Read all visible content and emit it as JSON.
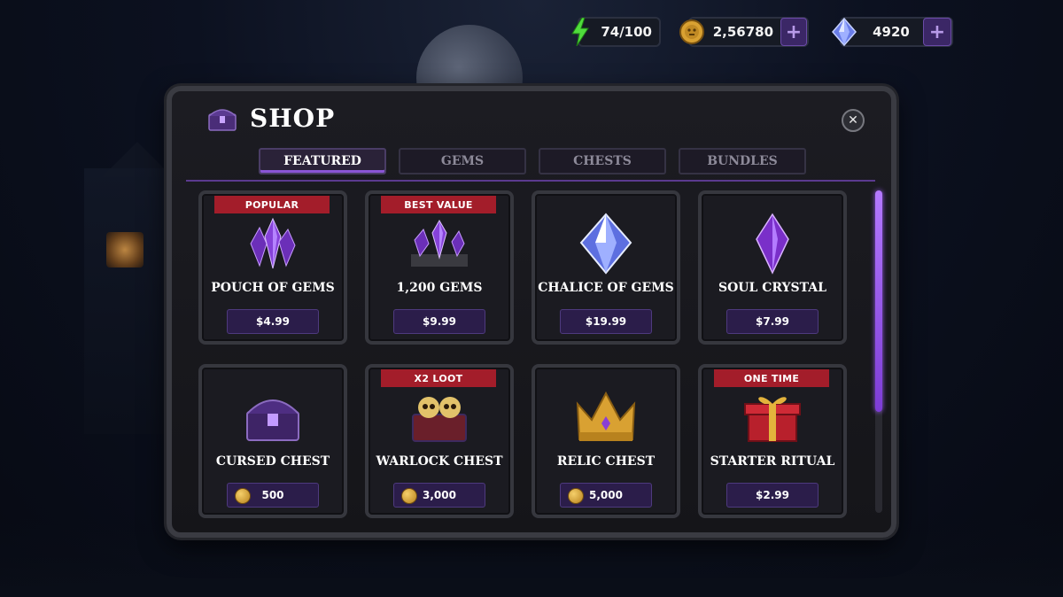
{
  "resources": {
    "energy": {
      "value": "74/100",
      "icon": "lightning-icon"
    },
    "gold": {
      "value": "2,56780",
      "icon": "coin-icon"
    },
    "gems": {
      "value": "4920",
      "icon": "diamond-icon"
    },
    "plus_label": "+"
  },
  "shop": {
    "title": "SHOP",
    "close_label": "✕",
    "tabs": [
      {
        "label": "FEATURED",
        "active": true
      },
      {
        "label": "GEMS",
        "active": false
      },
      {
        "label": "CHESTS",
        "active": false
      },
      {
        "label": "BUNDLES",
        "active": false
      }
    ],
    "items": [
      {
        "badge": "POPULAR",
        "name": "POUCH OF GEMS",
        "price": "$4.99",
        "icon": "gem-cluster-icon"
      },
      {
        "badge": "BEST VALUE",
        "name": "1,200 GEMS",
        "price": "$9.99",
        "icon": "gem-pile-icon"
      },
      {
        "badge": "",
        "name": "CHALICE OF GEMS",
        "price": "$19.99",
        "icon": "diamond-icon"
      },
      {
        "badge": "",
        "name": "SOUL CRYSTAL",
        "price": "$7.99",
        "icon": "crystal-icon"
      },
      {
        "badge": "",
        "name": "CURSED CHEST",
        "price": "500",
        "icon": "chest-icon",
        "currency": "coin"
      },
      {
        "badge": "X2 LOOT",
        "name": "WARLOCK CHEST",
        "price": "3,000",
        "icon": "skull-chest-icon",
        "currency": "coin"
      },
      {
        "badge": "",
        "name": "RELIC CHEST",
        "price": "5,000",
        "icon": "crown-icon",
        "currency": "coin"
      },
      {
        "badge": "ONE TIME",
        "name": "STARTER RITUAL",
        "price": "$2.99",
        "icon": "gift-icon"
      }
    ]
  },
  "colors": {
    "accent": "#8a55d6",
    "badge": "#a31d2a",
    "price_bg": "#2b1d4a"
  }
}
